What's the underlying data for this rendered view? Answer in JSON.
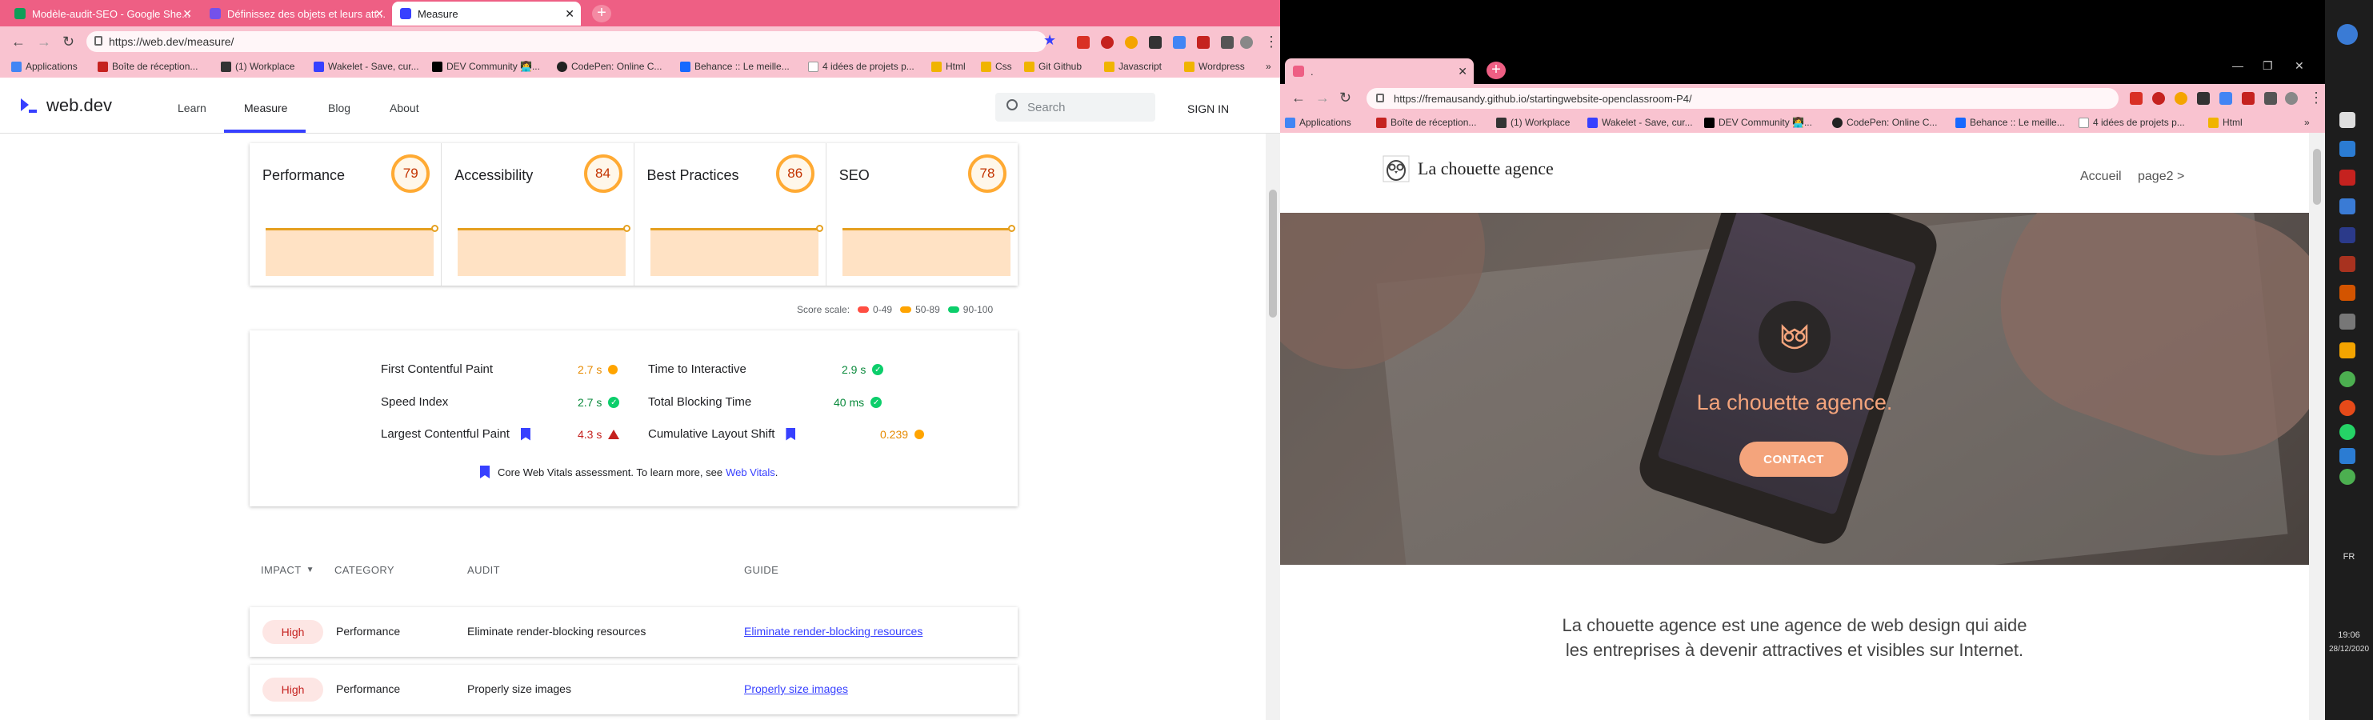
{
  "colors": {
    "chrome_pink": "#ee5f84",
    "toolbar_pink": "#f9c3d0",
    "webdev_blue": "#3740ff",
    "score_orange": "#e68a00",
    "score_green": "#0cce6b",
    "score_red": "#c5221f",
    "site_accent": "#f4a47c"
  },
  "left_browser": {
    "tabs": [
      {
        "title": "Modèle-audit-SEO - Google She...",
        "icon": "sheets-icon"
      },
      {
        "title": "Définissez des objets et leurs att...",
        "icon": "openclassrooms-icon"
      },
      {
        "title": "Measure",
        "icon": "webdev-icon",
        "active": true
      }
    ],
    "url": "https://web.dev/measure/",
    "bookmarks": [
      "Applications",
      "Boîte de réception...",
      "(1) Workplace",
      "Wakelet - Save, cur...",
      "DEV Community 👩‍💻...",
      "CodePen: Online C...",
      "Behance :: Le meille...",
      "4 idées de projets p...",
      "Html",
      "Css",
      "Git Github",
      "Javascript",
      "Wordpress"
    ],
    "bookmarks_more": "»"
  },
  "webdev": {
    "logo": "web.dev",
    "nav": [
      "Learn",
      "Measure",
      "Blog",
      "About"
    ],
    "search_placeholder": "Search",
    "signin": "SIGN IN",
    "scores": [
      {
        "name": "Performance",
        "value": "79"
      },
      {
        "name": "Accessibility",
        "value": "84"
      },
      {
        "name": "Best Practices",
        "value": "86"
      },
      {
        "name": "SEO",
        "value": "78"
      }
    ],
    "score_scale": {
      "label": "Score scale:",
      "ranges": [
        "0-49",
        "50-89",
        "90-100"
      ]
    },
    "metrics": [
      {
        "label": "First Contentful Paint",
        "value": "2.7 s",
        "status": "average"
      },
      {
        "label": "Time to Interactive",
        "value": "2.9 s",
        "status": "pass"
      },
      {
        "label": "Speed Index",
        "value": "2.7 s",
        "status": "pass"
      },
      {
        "label": "Total Blocking Time",
        "value": "40 ms",
        "status": "pass"
      },
      {
        "label": "Largest Contentful Paint",
        "value": "4.3 s",
        "status": "fail"
      },
      {
        "label": "Cumulative Layout Shift",
        "value": "0.239",
        "status": "average"
      }
    ],
    "cwv_note": "Core Web Vitals assessment. To learn more, see",
    "cwv_link": "Web Vitals",
    "cwv_period": ".",
    "table_headers": {
      "impact": "IMPACT",
      "category": "CATEGORY",
      "audit": "AUDIT",
      "guide": "GUIDE"
    },
    "audits": [
      {
        "impact": "High",
        "category": "Performance",
        "audit": "Eliminate render-blocking resources",
        "guide": "Eliminate render-blocking resources"
      },
      {
        "impact": "High",
        "category": "Performance",
        "audit": "Properly size images",
        "guide": "Properly size images"
      }
    ]
  },
  "right_browser": {
    "tab_title": ".",
    "url": "https://fremausandy.github.io/startingwebsite-openclassroom-P4/",
    "bookmarks": [
      "Applications",
      "Boîte de réception...",
      "(1) Workplace",
      "Wakelet - Save, cur...",
      "DEV Community 👩‍💻...",
      "CodePen: Online C...",
      "Behance :: Le meille...",
      "4 idées de projets p...",
      "Html"
    ],
    "bookmarks_more": "»"
  },
  "site": {
    "brand": "La chouette agence",
    "nav": [
      "Accueil",
      "page2 >"
    ],
    "hero_title": "La chouette agence.",
    "cta": "CONTACT",
    "intro_line1": "La chouette agence est une agence de web design qui aide",
    "intro_line2": "les entreprises à devenir attractives et visibles sur Internet."
  },
  "taskbar": {
    "lang": "FR",
    "time": "19:06",
    "date": "28/12/2020"
  }
}
